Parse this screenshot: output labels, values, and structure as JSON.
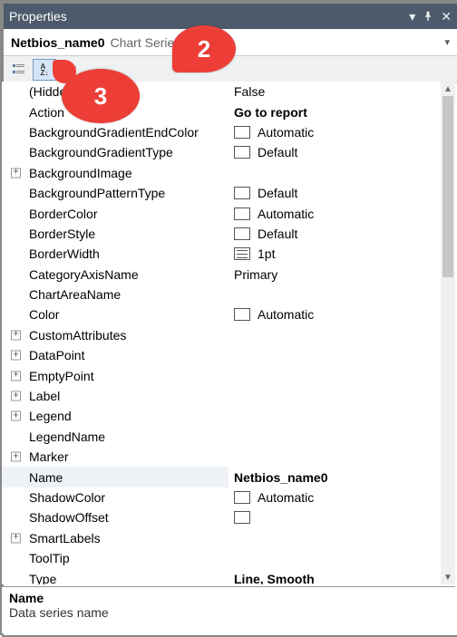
{
  "window": {
    "title": "Properties"
  },
  "selector": {
    "name": "Netbios_name0",
    "type": "Chart Series"
  },
  "callouts": {
    "two": "2",
    "three": "3"
  },
  "rows": [
    {
      "name": "(Hidden)",
      "value": "False",
      "expandable": false,
      "swatch": "",
      "bold": false
    },
    {
      "name": "Action",
      "value": "Go to report",
      "expandable": false,
      "swatch": "",
      "bold": true
    },
    {
      "name": "BackgroundGradientEndColor",
      "value": "Automatic",
      "expandable": false,
      "swatch": "color",
      "bold": false
    },
    {
      "name": "BackgroundGradientType",
      "value": "Default",
      "expandable": false,
      "swatch": "color",
      "bold": false
    },
    {
      "name": "BackgroundImage",
      "value": "",
      "expandable": true,
      "swatch": "",
      "bold": false
    },
    {
      "name": "BackgroundPatternType",
      "value": "Default",
      "expandable": false,
      "swatch": "color",
      "bold": false
    },
    {
      "name": "BorderColor",
      "value": "Automatic",
      "expandable": false,
      "swatch": "color",
      "bold": false
    },
    {
      "name": "BorderStyle",
      "value": "Default",
      "expandable": false,
      "swatch": "color",
      "bold": false
    },
    {
      "name": "BorderWidth",
      "value": "1pt",
      "expandable": false,
      "swatch": "border",
      "bold": false
    },
    {
      "name": "CategoryAxisName",
      "value": "Primary",
      "expandable": false,
      "swatch": "",
      "bold": false
    },
    {
      "name": "ChartAreaName",
      "value": "",
      "expandable": false,
      "swatch": "",
      "bold": false
    },
    {
      "name": "Color",
      "value": "Automatic",
      "expandable": false,
      "swatch": "color",
      "bold": false
    },
    {
      "name": "CustomAttributes",
      "value": "",
      "expandable": true,
      "swatch": "",
      "bold": false
    },
    {
      "name": "DataPoint",
      "value": "",
      "expandable": true,
      "swatch": "",
      "bold": false
    },
    {
      "name": "EmptyPoint",
      "value": "",
      "expandable": true,
      "swatch": "",
      "bold": false
    },
    {
      "name": "Label",
      "value": "",
      "expandable": true,
      "swatch": "",
      "bold": false
    },
    {
      "name": "Legend",
      "value": "",
      "expandable": true,
      "swatch": "",
      "bold": false
    },
    {
      "name": "LegendName",
      "value": "",
      "expandable": false,
      "swatch": "",
      "bold": false
    },
    {
      "name": "Marker",
      "value": "",
      "expandable": true,
      "swatch": "",
      "bold": false
    },
    {
      "name": "Name",
      "value": "Netbios_name0",
      "expandable": false,
      "swatch": "",
      "bold": true,
      "selected": true
    },
    {
      "name": "ShadowColor",
      "value": "Automatic",
      "expandable": false,
      "swatch": "color",
      "bold": false
    },
    {
      "name": "ShadowOffset",
      "value": "",
      "expandable": false,
      "swatch": "color",
      "bold": false
    },
    {
      "name": "SmartLabels",
      "value": "",
      "expandable": true,
      "swatch": "",
      "bold": false
    },
    {
      "name": "ToolTip",
      "value": "",
      "expandable": false,
      "swatch": "",
      "bold": false
    },
    {
      "name": "Type",
      "value": "Line, Smooth",
      "expandable": false,
      "swatch": "",
      "bold": true
    }
  ],
  "description": {
    "title": "Name",
    "text": "Data series name"
  }
}
